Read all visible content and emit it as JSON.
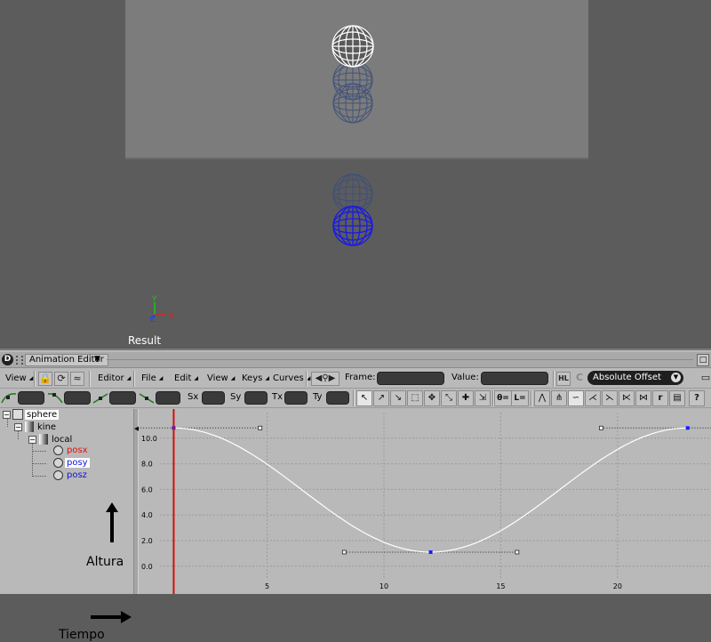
{
  "viewport": {
    "label": "Result",
    "axes": {
      "y": "Y",
      "x": "X",
      "z": "Z"
    }
  },
  "editor": {
    "title": "Animation Editor",
    "logo": "D",
    "menus": {
      "view": "View",
      "editor": "Editor",
      "file": "File",
      "edit": "Edit",
      "view2": "View",
      "keys": "Keys",
      "curves": "Curves"
    },
    "frame_label": "Frame:",
    "value_label": "Value:",
    "offset_mode": "Absolute Offset",
    "key_fields": {
      "sx": "Sx",
      "sy": "Sy",
      "tx": "Tx",
      "ty": "Ty"
    },
    "key_buttons": [
      "θ=",
      "L="
    ]
  },
  "explorer": {
    "root": "sphere",
    "kine": "kine",
    "local": "local",
    "channels": [
      {
        "name": "posx",
        "color": "#e01010"
      },
      {
        "name": "posy",
        "color": "#1010e0",
        "selected": true
      },
      {
        "name": "posz",
        "color": "#1010e0"
      }
    ]
  },
  "annotations": {
    "altura": "Altura",
    "tiempo": "Tiempo"
  },
  "colors": {
    "curve": "#ffffff",
    "current_frame": "#d01010",
    "key": "#1a1aff",
    "graph_bg": "#b9b9b9"
  },
  "chart_data": {
    "type": "line",
    "x_ticks": [
      5,
      10,
      15,
      20
    ],
    "y_ticks": [
      "0.0",
      "2.0",
      "4.0",
      "6.0",
      "8.0",
      "10.0"
    ],
    "xlim": [
      -0.5,
      24
    ],
    "ylim": [
      -0.5,
      12
    ],
    "current_frame": 1,
    "keys": [
      {
        "frame": 1,
        "value": 10.8
      },
      {
        "frame": 12,
        "value": 1.1
      },
      {
        "frame": 23,
        "value": 10.8
      }
    ],
    "series": [
      {
        "name": "posy"
      }
    ]
  }
}
